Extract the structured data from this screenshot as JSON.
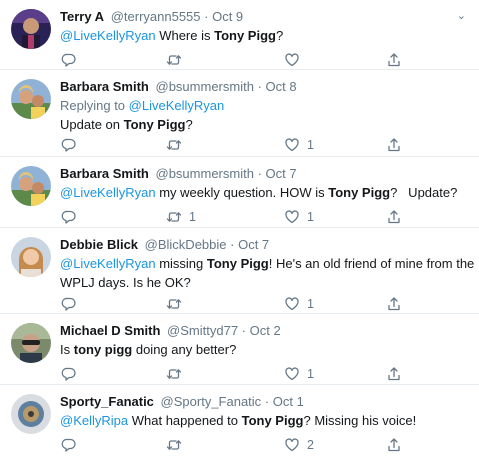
{
  "tweets": [
    {
      "name": "Terry A",
      "handle": "@terryann5555",
      "date": "Oct 9",
      "replying": null,
      "mention": "@LiveKellyRyan",
      "text1_pre": " Where is ",
      "bold": "Tony Pigg",
      "text1_post": "?",
      "line2": "",
      "replies": "",
      "retweets": "",
      "likes": "",
      "avatar_color": "#3a2f6b"
    },
    {
      "name": "Barbara Smith",
      "handle": "@bsummersmith",
      "date": "Oct 8",
      "replying_prefix": "Replying to ",
      "replying_to": "@LiveKellyRyan",
      "text1_pre": "Update on ",
      "bold": "Tony Pigg",
      "text1_post": "?",
      "replies": "",
      "retweets": "",
      "likes": "1",
      "avatar_color": "#7fa3c7"
    },
    {
      "name": "Barbara Smith",
      "handle": "@bsummersmith",
      "date": "Oct 7",
      "mention": "@LiveKellyRyan",
      "text1_pre": " my weekly question. HOW is ",
      "bold": "Tony Pigg",
      "text1_post": "?   Update?",
      "replies": "",
      "retweets": "1",
      "likes": "1",
      "avatar_color": "#7fa3c7"
    },
    {
      "name": "Debbie Blick",
      "handle": "@BlickDebbie",
      "date": "Oct 7",
      "mention": "@LiveKellyRyan",
      "text1_pre": " missing ",
      "bold": "Tony Pigg",
      "text1_post": "! He's an old friend of mine from the",
      "line2": "WPLJ days. Is he OK?",
      "replies": "",
      "retweets": "",
      "likes": "1",
      "avatar_color": "#d9b48a"
    },
    {
      "name": "Michael D Smith",
      "handle": "@Smittyd77",
      "date": "Oct 2",
      "text1_pre": "Is ",
      "bold": "tony pigg",
      "text1_post": " doing any better?",
      "replies": "",
      "retweets": "",
      "likes": "1",
      "avatar_color": "#4f5b45"
    },
    {
      "name": "Sporty_Fanatic",
      "handle": "@Sporty_Fanatic",
      "date": "Oct 1",
      "mention": "@KellyRipa",
      "text1_pre": " What happened to ",
      "bold": "Tony Pigg",
      "text1_post": "? Missing his voice!",
      "replies": "",
      "retweets": "",
      "likes": "2",
      "avatar_color": "#6b8aa8"
    }
  ],
  "separator": "·",
  "icons": {
    "reply": "reply-icon",
    "retweet": "retweet-icon",
    "like": "heart-icon",
    "share": "share-icon",
    "more": "chevron-down-icon"
  },
  "colors": {
    "link": "#1b95e0",
    "muted": "#657786",
    "border": "#e6ecf0"
  }
}
